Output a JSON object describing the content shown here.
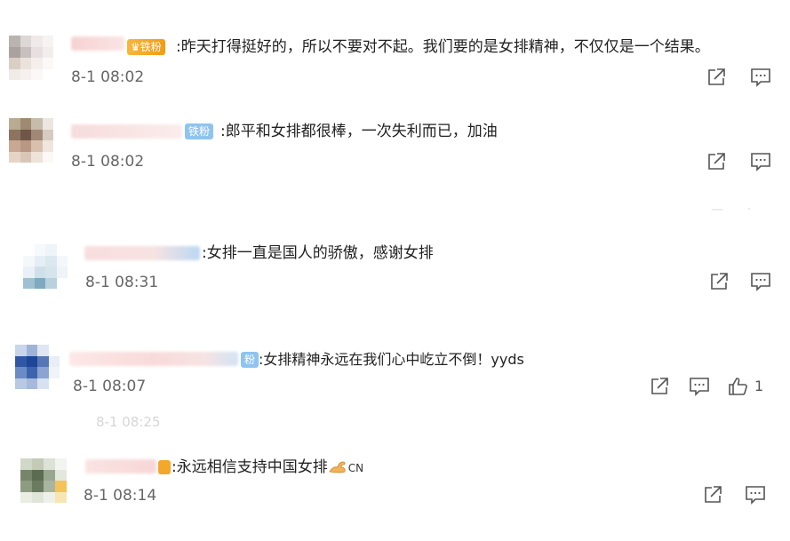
{
  "comments": [
    {
      "badge": "铁粉",
      "text": ":昨天打得挺好的，所以不要对不起。我们要的是女排精神，不仅仅是一个结果。",
      "time": "8-1 08:02"
    },
    {
      "badge": "铁粉",
      "text": ":郎平和女排都很棒，一次失利而已，加油",
      "time": "8-1 08:02"
    },
    {
      "badge": "",
      "text": ":女排一直是国人的骄傲，感谢女排",
      "time": "8-1 08:31"
    },
    {
      "badge": "粉",
      "text": ":女排精神永远在我们心中屹立不倒！yyds",
      "time": "8-1 08:07",
      "like_count": "1"
    },
    {
      "badge": "",
      "text": ":永远相信支持中国女排",
      "text_suffix": "CN",
      "time": "8-1 08:14"
    }
  ],
  "icons": {
    "share": "share-icon",
    "reply": "comment-icon",
    "like": "thumbs-up-icon",
    "flex": "flexed-biceps-emoji"
  },
  "colors": {
    "time": "#666666",
    "badge_gold": "#f39c12",
    "badge_blue": "#8fc4ee",
    "icon": "#555555"
  }
}
